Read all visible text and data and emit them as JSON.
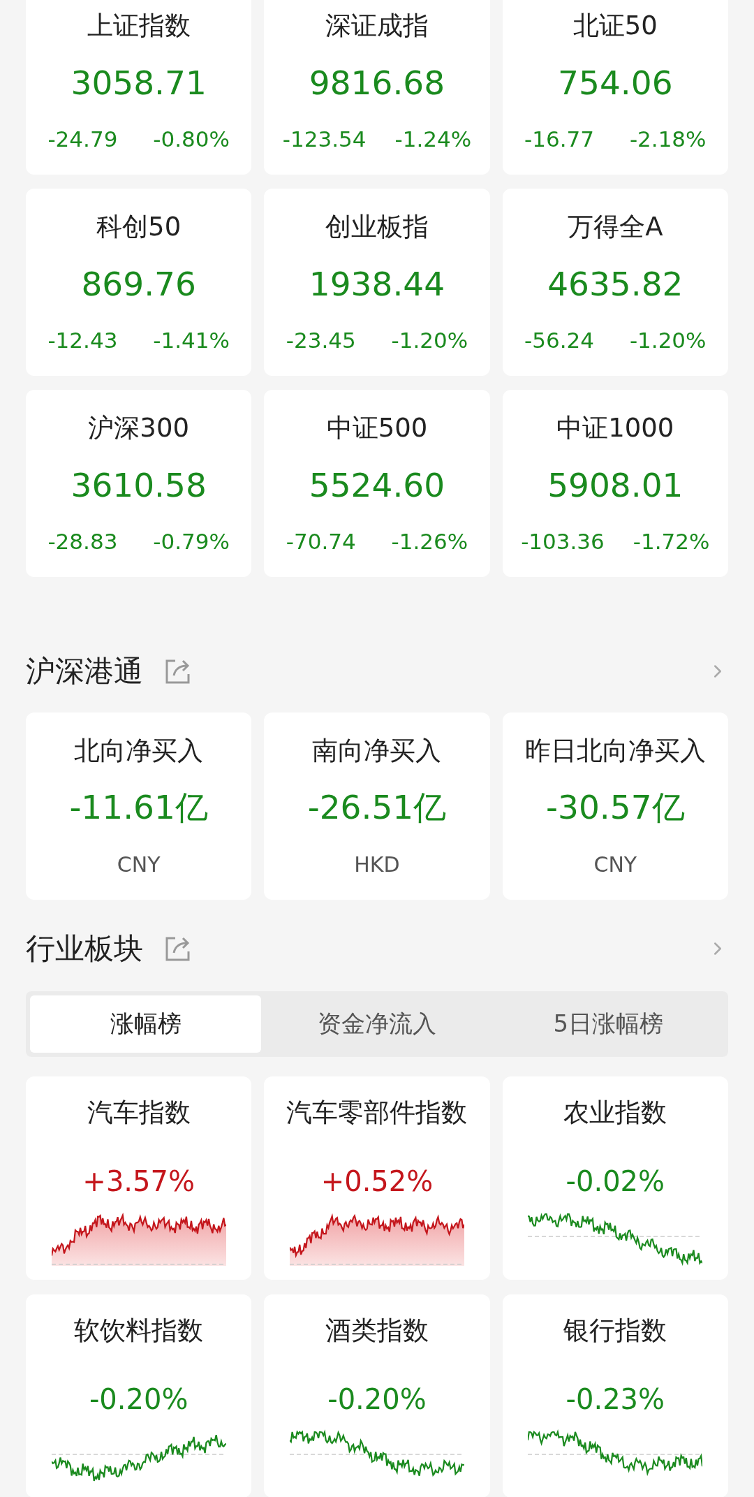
{
  "indices": [
    {
      "name": "上证指数",
      "value": "3058.71",
      "change": "-24.79",
      "percent": "-0.80%",
      "color": "#1a8a1e"
    },
    {
      "name": "深证成指",
      "value": "9816.68",
      "change": "-123.54",
      "percent": "-1.24%",
      "color": "#1a8a1e"
    },
    {
      "name": "北证50",
      "value": "754.06",
      "change": "-16.77",
      "percent": "-2.18%",
      "color": "#1a8a1e"
    },
    {
      "name": "科创50",
      "value": "869.76",
      "change": "-12.43",
      "percent": "-1.41%",
      "color": "#1a8a1e"
    },
    {
      "name": "创业板指",
      "value": "1938.44",
      "change": "-23.45",
      "percent": "-1.20%",
      "color": "#1a8a1e"
    },
    {
      "name": "万得全A",
      "value": "4635.82",
      "change": "-56.24",
      "percent": "-1.20%",
      "color": "#1a8a1e"
    },
    {
      "name": "沪深300",
      "value": "3610.58",
      "change": "-28.83",
      "percent": "-0.79%",
      "color": "#1a8a1e"
    },
    {
      "name": "中证500",
      "value": "5524.60",
      "change": "-70.74",
      "percent": "-1.26%",
      "color": "#1a8a1e"
    },
    {
      "name": "中证1000",
      "value": "5908.01",
      "change": "-103.36",
      "percent": "-1.72%",
      "color": "#1a8a1e"
    }
  ],
  "connect": {
    "title": "沪深港通",
    "items": [
      {
        "name": "北向净买入",
        "value": "-11.61亿",
        "currency": "CNY",
        "color": "#1a8a1e"
      },
      {
        "name": "南向净买入",
        "value": "-26.51亿",
        "currency": "HKD",
        "color": "#1a8a1e"
      },
      {
        "name": "昨日北向净买入",
        "value": "-30.57亿",
        "currency": "CNY",
        "color": "#1a8a1e"
      }
    ]
  },
  "sectors": {
    "title": "行业板块",
    "tabs": [
      {
        "label": "涨幅榜",
        "selected": true
      },
      {
        "label": "资金净流入",
        "selected": false
      },
      {
        "label": "5日涨幅榜",
        "selected": false
      }
    ],
    "items": [
      {
        "name": "汽车指数",
        "percent": "+3.57%",
        "color": "#c4161c"
      },
      {
        "name": "汽车零部件指数",
        "percent": "+0.52%",
        "color": "#c4161c"
      },
      {
        "name": "农业指数",
        "percent": "-0.02%",
        "color": "#1a8a1e"
      },
      {
        "name": "软饮料指数",
        "percent": "-0.20%",
        "color": "#1a8a1e"
      },
      {
        "name": "酒类指数",
        "percent": "-0.20%",
        "color": "#1a8a1e"
      },
      {
        "name": "银行指数",
        "percent": "-0.23%",
        "color": "#1a8a1e"
      }
    ]
  }
}
